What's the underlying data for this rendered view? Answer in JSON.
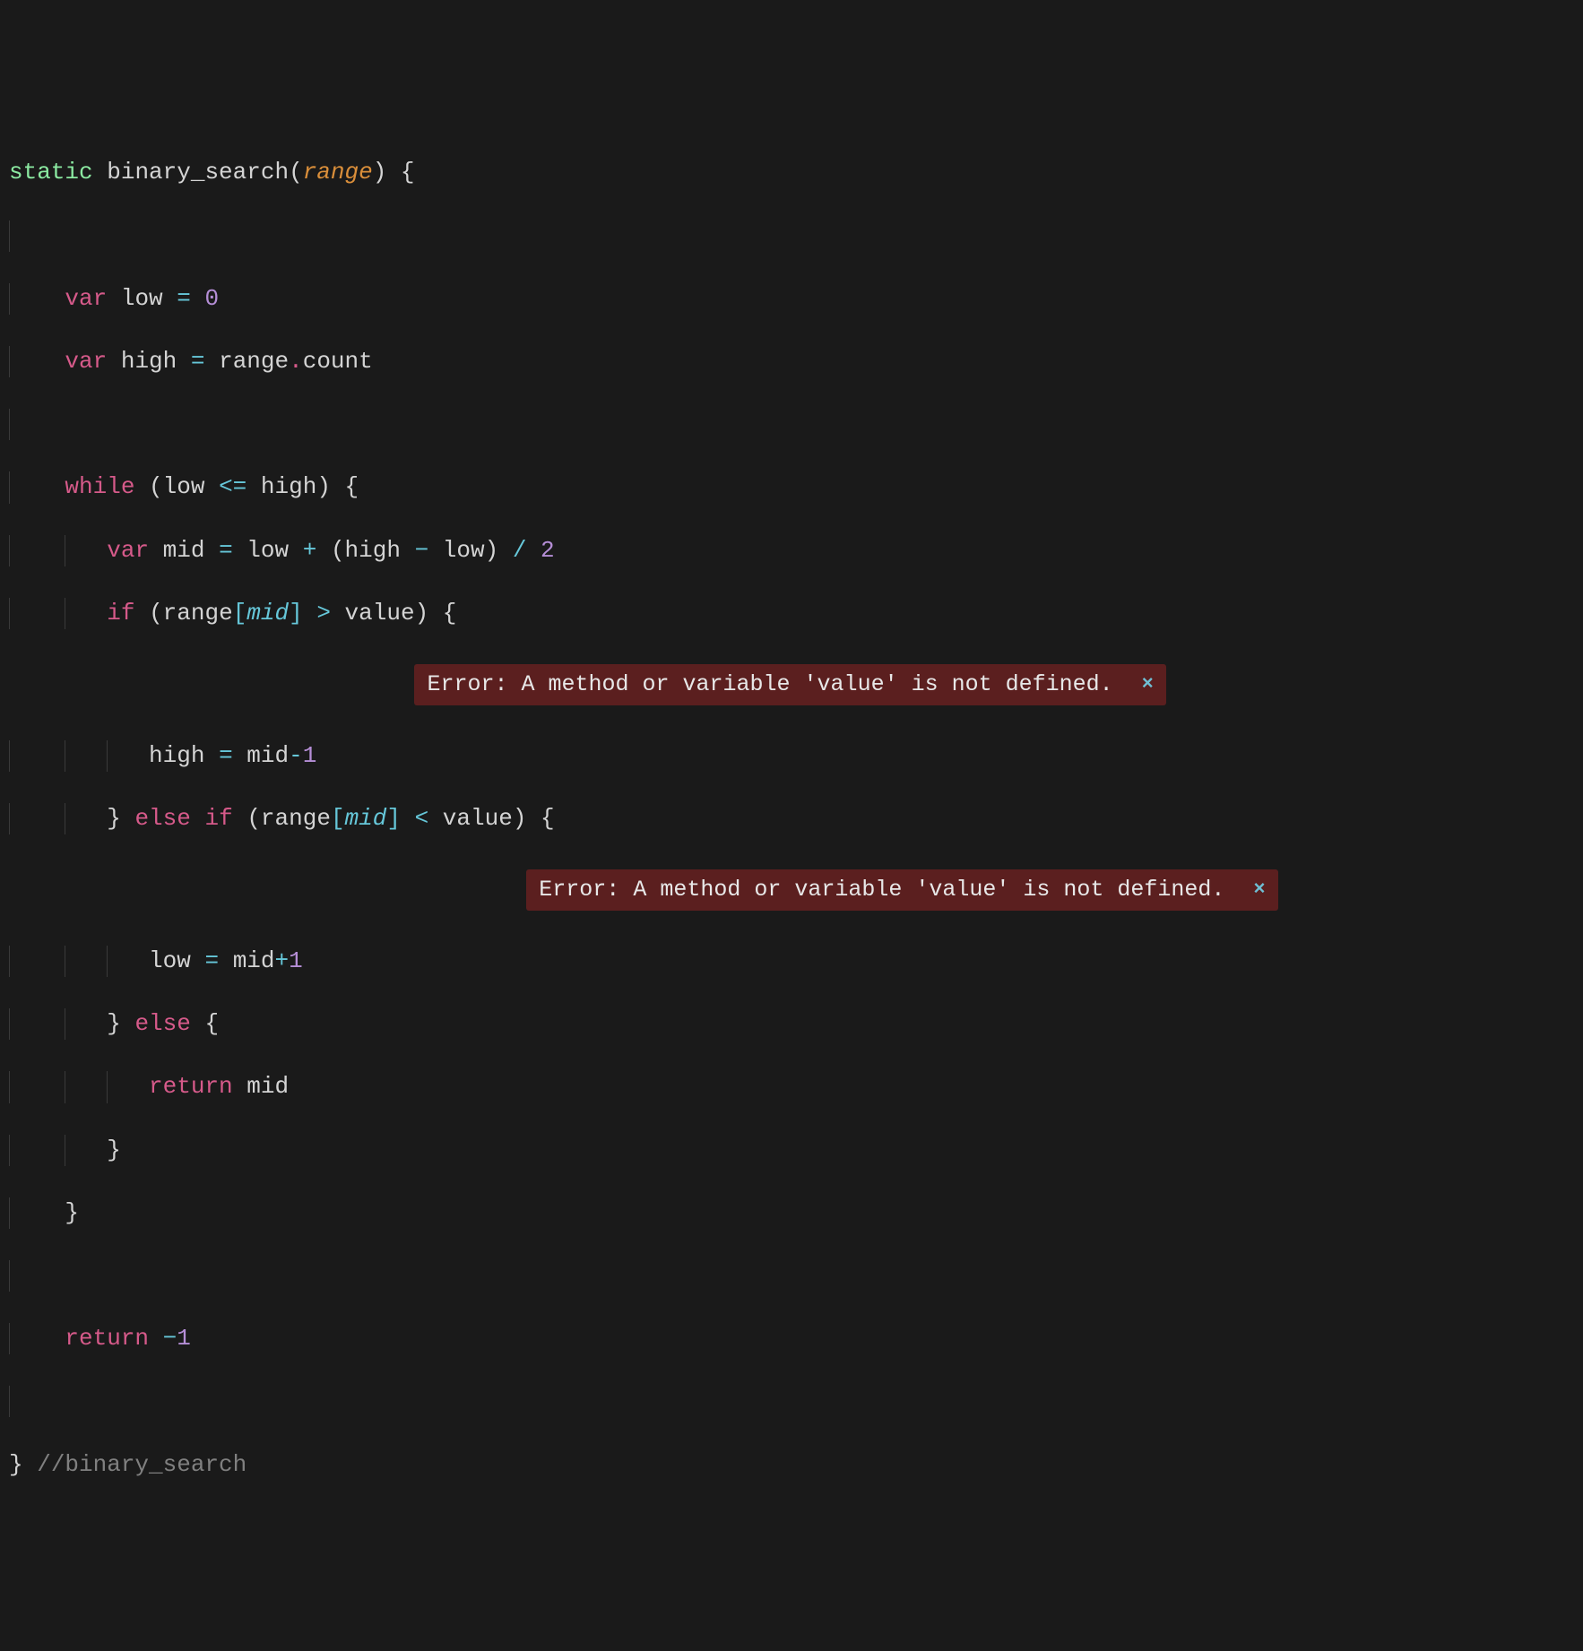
{
  "code": {
    "kw_static": "static",
    "fn_name": "binary_search",
    "param_range": "range",
    "kw_var1": "var",
    "id_low": "low",
    "eq": "=",
    "num_zero": "0",
    "kw_var2": "var",
    "id_high": "high",
    "id_range": "range",
    "dot": ".",
    "id_count": "count",
    "kw_while": "while",
    "lparen": "(",
    "rparen": ")",
    "lbrace": "{",
    "rbrace": "}",
    "op_le": "<=",
    "kw_var3": "var",
    "id_mid": "mid",
    "op_plus": "+",
    "op_minus": "−",
    "op_div": "/",
    "num_two": "2",
    "kw_if": "if",
    "lbracket": "[",
    "rbracket": "]",
    "sub_mid": "mid",
    "op_gt": ">",
    "id_value": "value",
    "num_one": "1",
    "op_minus_ascii": "-",
    "kw_else": "else",
    "op_lt": "<",
    "op_plus_ascii": "+",
    "kw_return": "return",
    "num_neg_one_minus": "−",
    "num_neg_one": "1",
    "comment_end": "//binary_search"
  },
  "errors": {
    "msg1": "Error: A method or variable 'value' is not defined.",
    "msg2": "Error: A method or variable 'value' is not defined.",
    "close": "×"
  }
}
